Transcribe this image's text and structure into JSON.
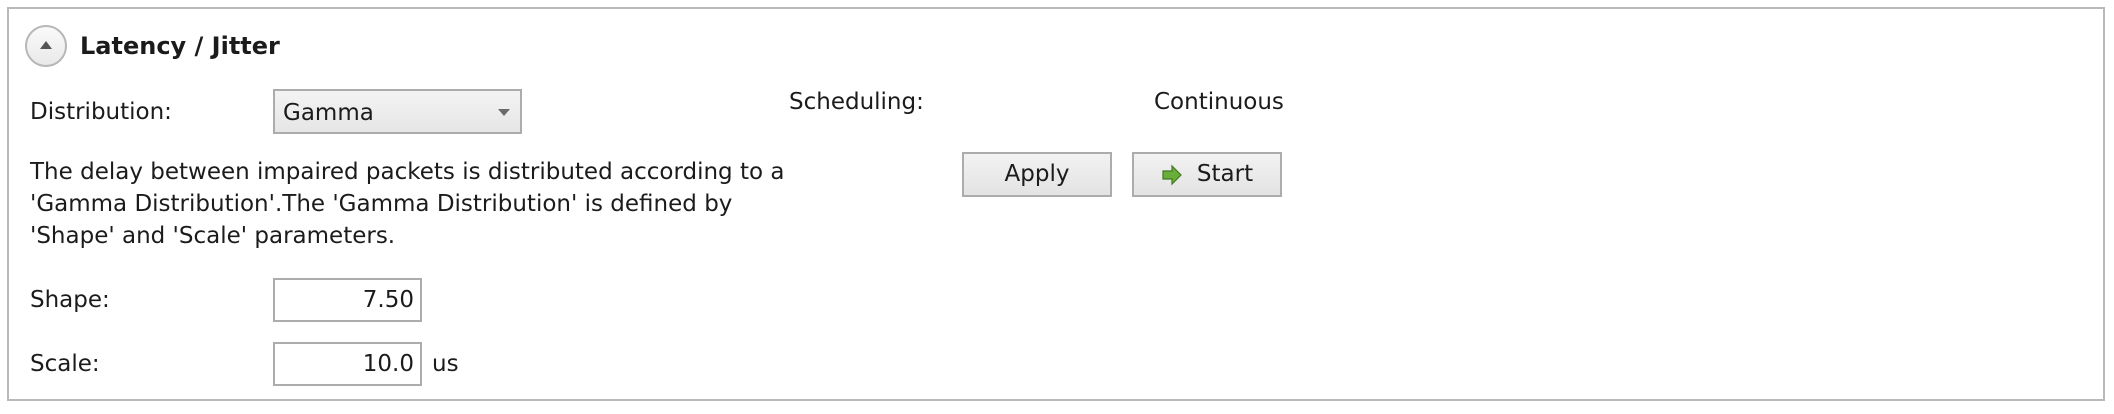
{
  "section": {
    "title": "Latency / Jitter",
    "collapse_icon": "chevron-up-icon"
  },
  "distribution": {
    "label": "Distribution:",
    "selected": "Gamma"
  },
  "description": "The delay between impaired packets is distributed according to a 'Gamma Distribution'.The 'Gamma Distribution' is defined by 'Shape' and 'Scale' parameters.",
  "shape": {
    "label": "Shape:",
    "value": "7.50"
  },
  "scale": {
    "label": "Scale:",
    "value": "10.0",
    "unit": "us"
  },
  "scheduling": {
    "label": "Scheduling:",
    "value": "Continuous"
  },
  "buttons": {
    "apply_label": "Apply",
    "start_label": "Start",
    "start_icon": "play-arrow-icon",
    "start_icon_color": "#5a9e2f"
  }
}
